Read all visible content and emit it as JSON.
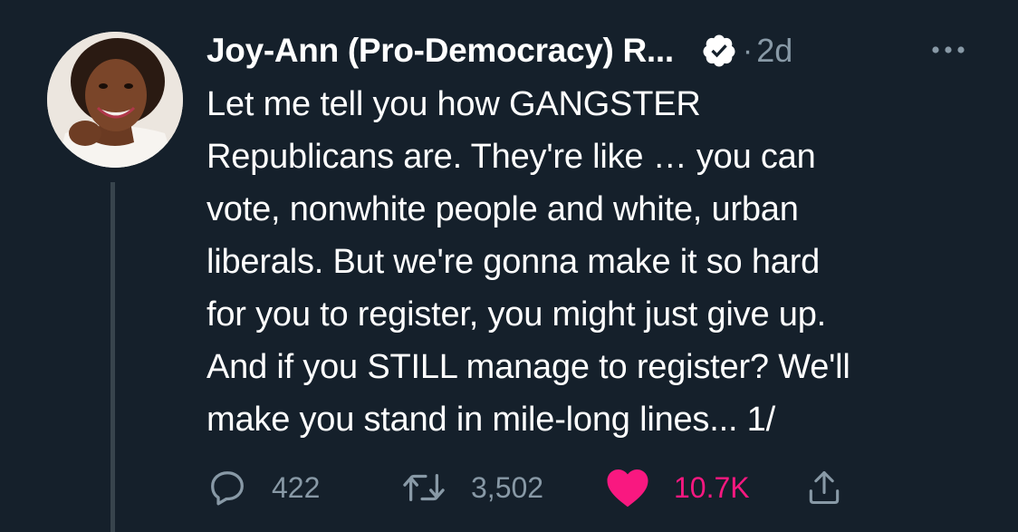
{
  "tweet": {
    "author_name": "Joy-Ann (Pro-Democracy) R...",
    "separator": "·",
    "timestamp": "2d",
    "text": "Let me tell you how GANGSTER\nRepublicans are. They're like … you can\nvote, nonwhite people and white, urban\nliberals. But we're gonna make it so hard\nfor you to register, you might just give up.\nAnd if you STILL manage to register? We'll\nmake you stand in mile-long lines... 1/",
    "replies": "422",
    "retweets": "3,502",
    "likes": "10.7K"
  },
  "icons": {
    "avatar": "avatar-photo",
    "verified": "verified-badge-icon",
    "more": "more-options-icon",
    "reply": "reply-icon",
    "retweet": "retweet-icon",
    "like": "heart-icon",
    "share": "share-icon"
  },
  "colors": {
    "background": "#15202b",
    "text": "#ffffff",
    "secondary": "#8899a6",
    "like": "#f91880",
    "thread_line": "#38444d"
  }
}
